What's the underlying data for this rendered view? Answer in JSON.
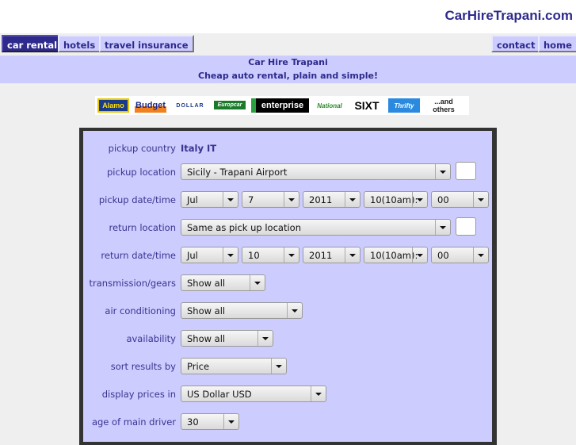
{
  "site": {
    "title": "CarHireTrapani.com"
  },
  "nav": {
    "left": [
      {
        "label": "car rental",
        "active": true
      },
      {
        "label": "hotels",
        "active": false
      },
      {
        "label": "travel insurance",
        "active": false
      }
    ],
    "right": [
      {
        "label": "contact"
      },
      {
        "label": "home"
      }
    ]
  },
  "banner": {
    "title": "Car Hire Trapani",
    "subtitle": "Cheap auto rental, plain and simple!"
  },
  "logos": {
    "items": [
      "Alamo",
      "Budget",
      "DOLLAR",
      "Europcar",
      "enterprise",
      "National",
      "SIXT",
      "Thrifty"
    ],
    "others_line1": "...and",
    "others_line2": "others"
  },
  "form": {
    "pickup_country": {
      "label": "pickup country",
      "value": "Italy IT"
    },
    "pickup_location": {
      "label": "pickup location",
      "value": "Sicily - Trapani Airport"
    },
    "pickup_datetime": {
      "label": "pickup date/time",
      "month": "Jul",
      "day": "7",
      "year": "2011",
      "hour": "10(10am):",
      "minute": "00"
    },
    "return_location": {
      "label": "return location",
      "value": "Same as pick up location"
    },
    "return_datetime": {
      "label": "return date/time",
      "month": "Jul",
      "day": "10",
      "year": "2011",
      "hour": "10(10am):",
      "minute": "00"
    },
    "transmission": {
      "label": "transmission/gears",
      "value": "Show all"
    },
    "air_conditioning": {
      "label": "air conditioning",
      "value": "Show all"
    },
    "availability": {
      "label": "availability",
      "value": "Show all"
    },
    "sort_by": {
      "label": "sort results by",
      "value": "Price"
    },
    "currency": {
      "label": "display prices in",
      "value": "US Dollar USD"
    },
    "driver_age": {
      "label": "age of main driver",
      "value": "30"
    }
  },
  "colors": {
    "accent": "#2e2a8c",
    "panel": "#ccccff",
    "background": "#efefef"
  }
}
